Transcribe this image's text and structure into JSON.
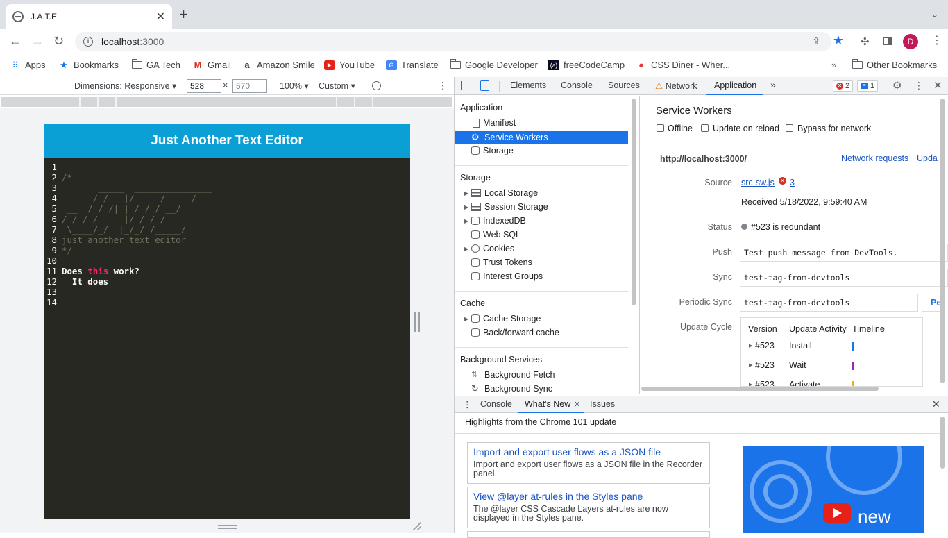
{
  "browser": {
    "tab_title": "J.A.T.E",
    "url_host": "localhost",
    "url_port": ":3000",
    "avatar_letter": "D"
  },
  "bookmarks": [
    {
      "label": "Apps",
      "icon": "apps-grid-icon"
    },
    {
      "label": "Bookmarks",
      "icon": "star-icon"
    },
    {
      "label": "GA Tech",
      "icon": "folder-icon"
    },
    {
      "label": "Gmail",
      "icon": "gmail-icon"
    },
    {
      "label": "Amazon Smile",
      "icon": "amazon-icon"
    },
    {
      "label": "YouTube",
      "icon": "youtube-icon"
    },
    {
      "label": "Translate",
      "icon": "translate-icon"
    },
    {
      "label": "Google Developer",
      "icon": "folder-icon"
    },
    {
      "label": "freeCodeCamp",
      "icon": "freecodecamp-icon"
    },
    {
      "label": "CSS Diner - Wher...",
      "icon": "css-diner-icon"
    },
    {
      "label": "Other Bookmarks",
      "icon": "folder-icon"
    }
  ],
  "device_toolbar": {
    "dimensions": "Dimensions: Responsive ▾",
    "width": "528",
    "times": "×",
    "height": "570",
    "zoom": "100% ▾",
    "throttle": "Custom ▾"
  },
  "app": {
    "header": "Just Another Text Editor",
    "code_lines": [
      {
        "n": "1",
        "segments": []
      },
      {
        "n": "2",
        "segments": [
          {
            "t": "/*",
            "c": "cmt"
          }
        ]
      },
      {
        "n": "3",
        "segments": [
          {
            "t": "       _____  _______________",
            "c": "cmt"
          }
        ]
      },
      {
        "n": "4",
        "segments": [
          {
            "t": "      / /   |/_  __/ ____/",
            "c": "cmt"
          }
        ]
      },
      {
        "n": "5",
        "segments": [
          {
            "t": " __  / / /| | / / / __/",
            "c": "cmt"
          }
        ]
      },
      {
        "n": "6",
        "segments": [
          {
            "t": "/ /_/ / ___ |/ / / /___",
            "c": "cmt"
          }
        ]
      },
      {
        "n": "7",
        "segments": [
          {
            "t": " \\____/_/  |_/_/ /_____/",
            "c": "cmt"
          }
        ]
      },
      {
        "n": "8",
        "segments": [
          {
            "t": "just another text editor",
            "c": "cmt"
          }
        ]
      },
      {
        "n": "9",
        "segments": [
          {
            "t": "*/",
            "c": "cmt"
          }
        ]
      },
      {
        "n": "10",
        "segments": []
      },
      {
        "n": "11",
        "segments": [
          {
            "t": "Does ",
            "c": "bold"
          },
          {
            "t": "this",
            "c": "kw bold"
          },
          {
            "t": " work?",
            "c": "bold"
          }
        ]
      },
      {
        "n": "12",
        "segments": [
          {
            "t": "  It does",
            "c": "bold"
          }
        ]
      },
      {
        "n": "13",
        "segments": []
      },
      {
        "n": "14",
        "segments": []
      }
    ]
  },
  "devtools": {
    "tabs": [
      "Elements",
      "Console",
      "Sources",
      "Network",
      "Application"
    ],
    "error_count": "2",
    "message_count": "1",
    "sidebar": {
      "application_header": "Application",
      "application_items": [
        "Manifest",
        "Service Workers",
        "Storage"
      ],
      "storage_header": "Storage",
      "storage_items": [
        "Local Storage",
        "Session Storage",
        "IndexedDB",
        "Web SQL",
        "Cookies",
        "Trust Tokens",
        "Interest Groups"
      ],
      "cache_header": "Cache",
      "cache_items": [
        "Cache Storage",
        "Back/forward cache"
      ],
      "background_header": "Background Services",
      "background_items": [
        "Background Fetch",
        "Background Sync"
      ]
    },
    "sw": {
      "title": "Service Workers",
      "offline": "Offline",
      "update_on_reload": "Update on reload",
      "bypass": "Bypass for network",
      "origin": "http://localhost:3000/",
      "network_requests": "Network requests",
      "update_link": "Upda",
      "source_label": "Source",
      "source_file": "src-sw.js",
      "source_errors": "3",
      "received": "Received 5/18/2022, 9:59:40 AM",
      "status_label": "Status",
      "status_value": "#523 is redundant",
      "push_label": "Push",
      "push_value": "Test push message from DevTools.",
      "sync_label": "Sync",
      "sync_value": "test-tag-from-devtools",
      "periodic_label": "Periodic Sync",
      "periodic_value": "test-tag-from-devtools",
      "periodic_btn": "Pe",
      "update_cycle_label": "Update Cycle",
      "table_headers": [
        "Version",
        "Update Activity",
        "Timeline"
      ],
      "table_rows": [
        {
          "version": "#523",
          "activity": "Install",
          "color": "#1a73e8"
        },
        {
          "version": "#523",
          "activity": "Wait",
          "color": "#9c27b0"
        },
        {
          "version": "#523",
          "activity": "Activate",
          "color": "#f9ab00"
        }
      ]
    },
    "drawer": {
      "tabs": [
        "Console",
        "What's New",
        "Issues"
      ],
      "highlights": "Highlights from the Chrome 101 update",
      "cards": [
        {
          "title": "Import and export user flows as a JSON file",
          "desc": "Import and export user flows as a JSON file in the Recorder panel."
        },
        {
          "title": "View @layer at-rules in the Styles pane",
          "desc": "The @layer CSS Cascade Layers at-rules are now displayed in the Styles pane."
        }
      ],
      "promo_text": "new"
    }
  }
}
